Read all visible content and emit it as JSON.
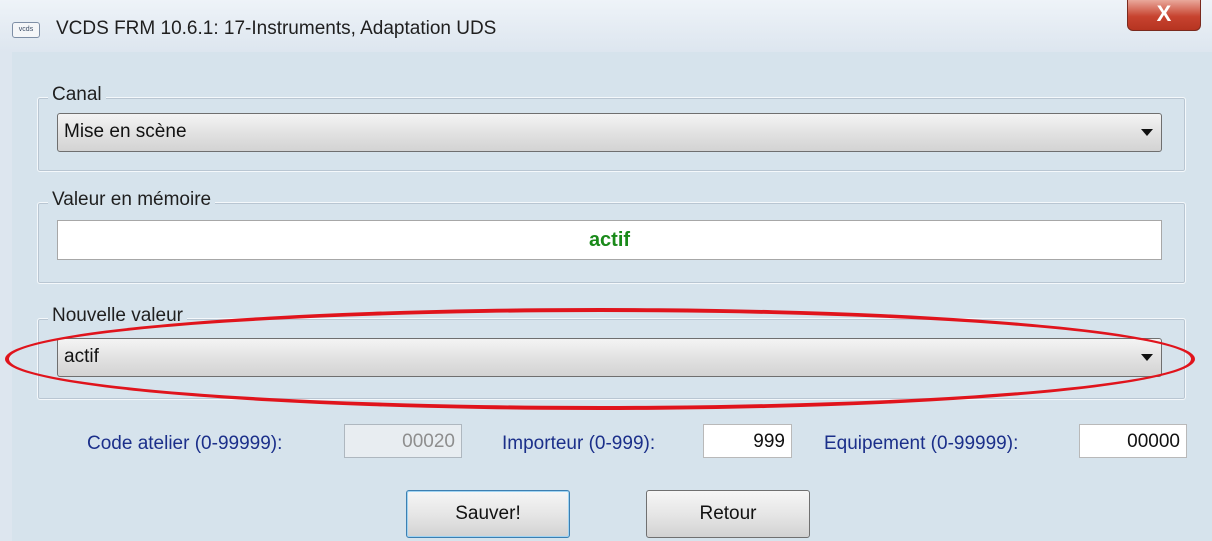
{
  "window": {
    "title": "VCDS FRM 10.6.1: 17-Instruments,  Adaptation UDS",
    "icon_text": "vcds",
    "close_label": "X"
  },
  "canal": {
    "label": "Canal",
    "selected": "Mise en scène"
  },
  "memory": {
    "label": "Valeur en mémoire",
    "value": "actif",
    "value_color": "#1a8a1a"
  },
  "new_value": {
    "label": "Nouvelle valeur",
    "selected": "actif",
    "annotation_color": "#e0141c"
  },
  "codes": {
    "workshop_label": "Code atelier (0-99999):",
    "workshop_value": "00020",
    "importer_label": "Importeur (0-999):",
    "importer_value": "999",
    "equipment_label": "Equipement (0-99999):",
    "equipment_value": "00000"
  },
  "buttons": {
    "save": "Sauver!",
    "back": "Retour"
  }
}
